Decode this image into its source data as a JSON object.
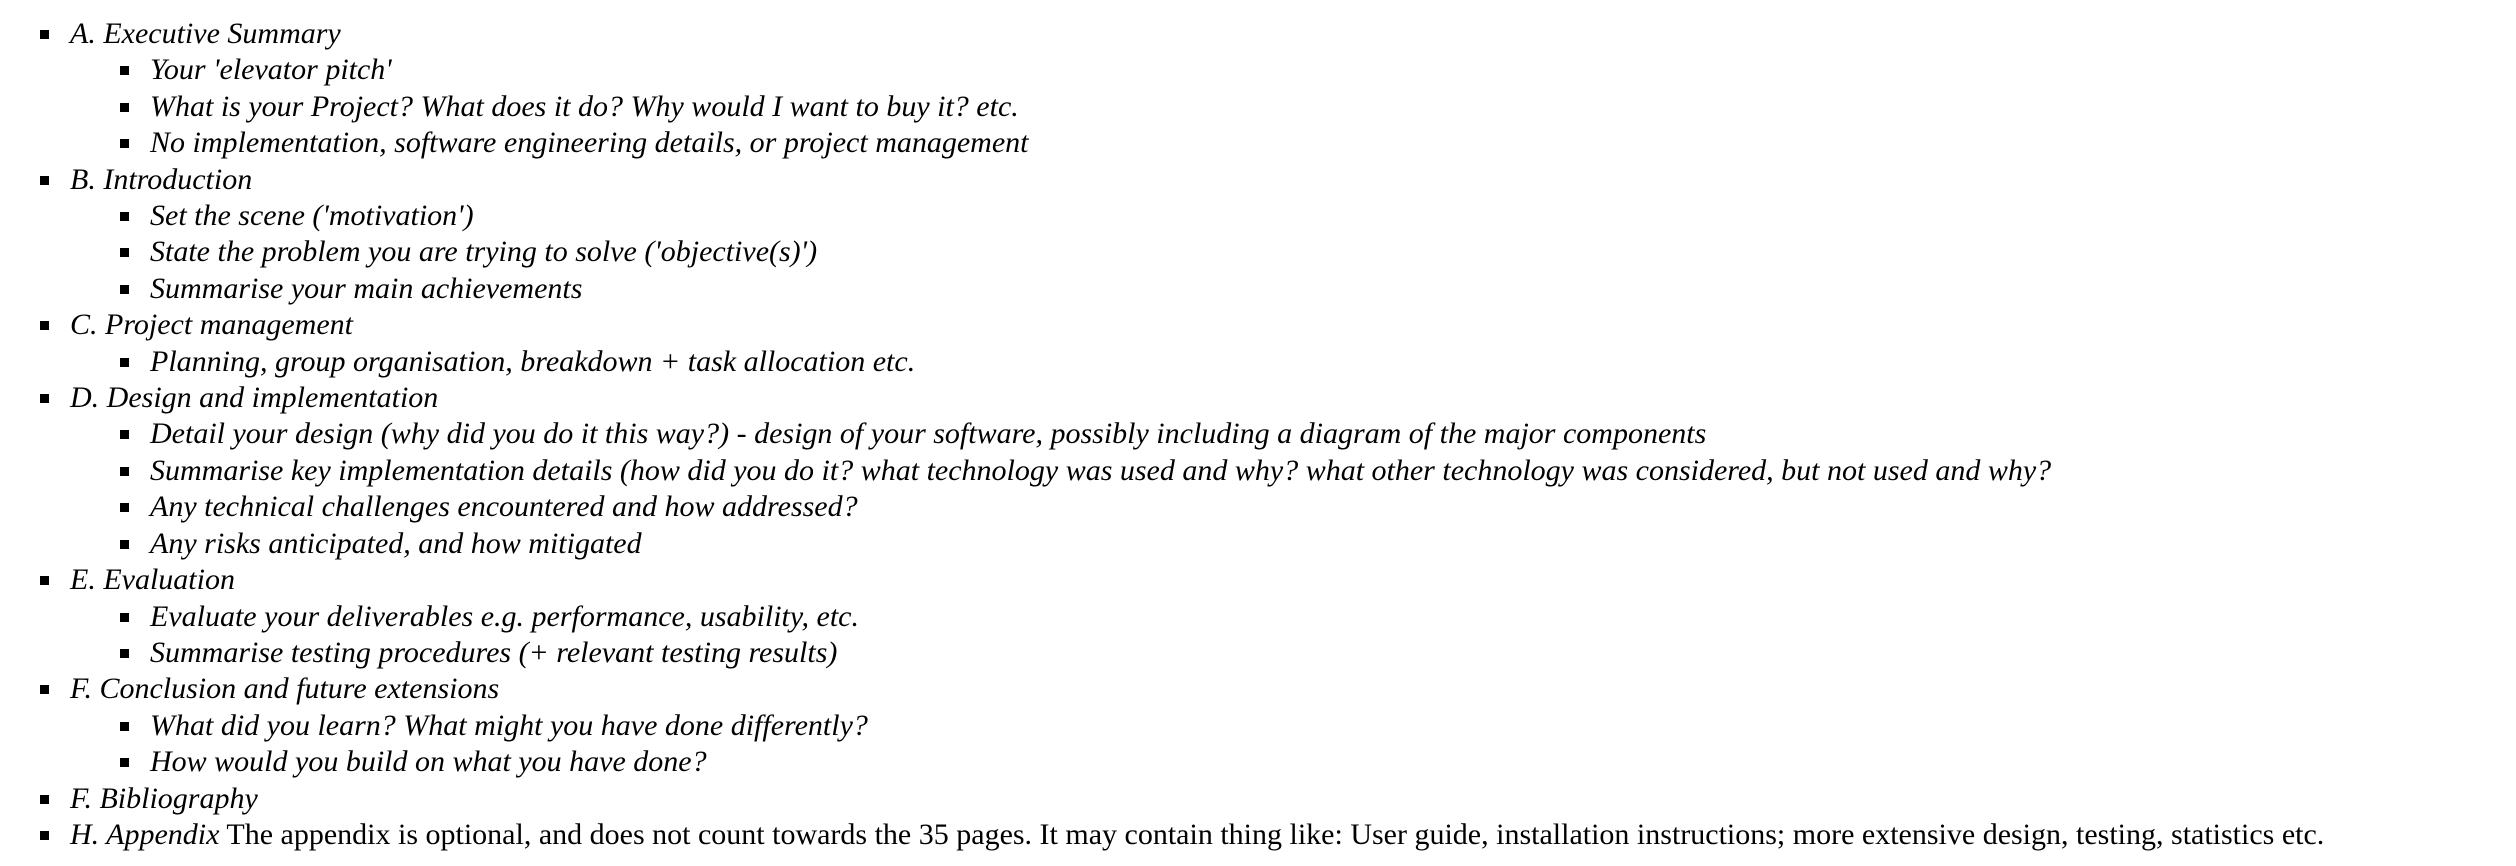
{
  "outline": {
    "sections": [
      {
        "title": "A. Executive Summary",
        "items": [
          "Your 'elevator pitch'",
          "What is your Project? What does it do? Why would I want to buy it? etc.",
          "No implementation, software engineering details, or project management"
        ]
      },
      {
        "title": "B. Introduction",
        "items": [
          "Set the scene ('motivation')",
          "State the problem you are trying to solve ('objective(s)')",
          "Summarise your main achievements"
        ]
      },
      {
        "title": "C. Project management",
        "items": [
          "Planning, group organisation, breakdown + task allocation etc."
        ]
      },
      {
        "title": "D. Design and implementation",
        "items": [
          "Detail your design (why did you do it this way?) - design of your software, possibly including a diagram of the major components",
          "Summarise key implementation details (how did you do it? what technology was used and why? what other technology was considered, but not used and why?",
          "Any technical challenges encountered and how addressed?",
          "Any risks anticipated, and how mitigated"
        ]
      },
      {
        "title": "E. Evaluation",
        "items": [
          "Evaluate your deliverables e.g. performance, usability, etc.",
          "Summarise testing procedures (+ relevant testing results)"
        ]
      },
      {
        "title": "F. Conclusion and future extensions",
        "items": [
          "What did you learn? What might you have done differently?",
          "How would you build on what you have done?"
        ]
      },
      {
        "title": "F. Bibliography",
        "items": []
      },
      {
        "title": "H. Appendix",
        "note": "The appendix is optional, and does not count towards the 35 pages. It may contain thing like: User guide, installation instructions; more extensive design, testing, statistics etc.",
        "items": []
      }
    ]
  }
}
